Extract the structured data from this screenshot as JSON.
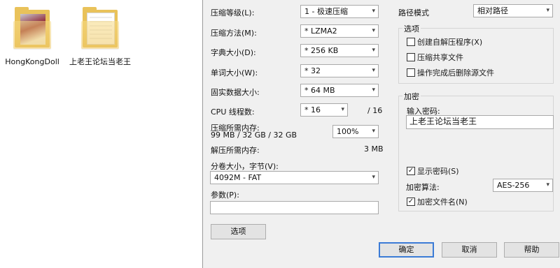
{
  "desktop": {
    "icons": [
      {
        "label": "HongKongDoll"
      },
      {
        "label": "上老王论坛当老王"
      }
    ]
  },
  "dialog": {
    "left": {
      "level_label": "压缩等级(L):",
      "level_value": "1 - 极速压缩",
      "method_label": "压缩方法(M):",
      "method_value": "* LZMA2",
      "dict_label": "字典大小(D):",
      "dict_value": "* 256 KB",
      "word_label": "单词大小(W):",
      "word_value": "* 32",
      "solid_label": "固实数据大小:",
      "solid_value": "* 64 MB",
      "cpu_label": "CPU 线程数:",
      "cpu_value": "* 16",
      "cpu_total": "/ 16",
      "mem_comp_label": "压缩所需内存:",
      "mem_comp_detail": "99 MB / 32 GB / 32 GB",
      "mem_percent": "100%",
      "mem_decomp_label": "解压所需内存:",
      "mem_decomp_value": "3 MB",
      "split_label": "分卷大小，字节(V):",
      "split_value": "4092M - FAT",
      "params_label": "参数(P):",
      "params_value": "",
      "options_button": "选项"
    },
    "right": {
      "path_mode_label": "路径模式",
      "path_mode_value": "相对路径",
      "options_group": "选项",
      "opt_sfx": "创建自解压程序(X)",
      "opt_shared": "压缩共享文件",
      "opt_delete": "操作完成后删除源文件",
      "encrypt_group": "加密",
      "password_label": "输入密码:",
      "password_value": "上老王论坛当老王",
      "show_password": "显示密码(S)",
      "method_label": "加密算法:",
      "method_value": "AES-256",
      "encrypt_names": "加密文件名(N)"
    },
    "buttons": {
      "ok": "确定",
      "cancel": "取消",
      "help": "帮助"
    }
  },
  "checkmark": "✓",
  "arrow": "▾"
}
